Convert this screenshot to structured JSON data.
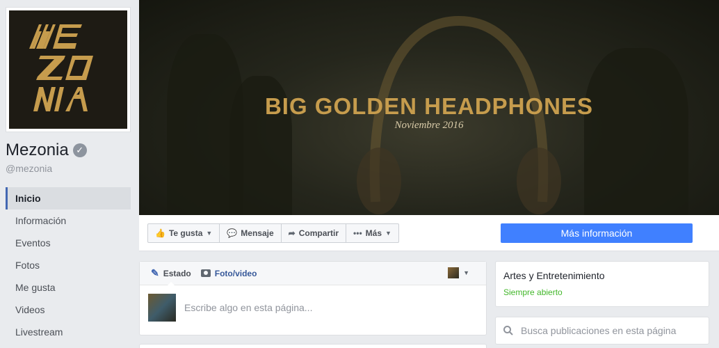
{
  "page": {
    "logo_text": [
      "ME",
      "ZO",
      "NIA"
    ],
    "name": "Mezonia",
    "handle": "@mezonia"
  },
  "nav": {
    "items": [
      {
        "label": "Inicio"
      },
      {
        "label": "Información"
      },
      {
        "label": "Eventos"
      },
      {
        "label": "Fotos"
      },
      {
        "label": "Me gusta"
      },
      {
        "label": "Videos"
      },
      {
        "label": "Livestream"
      }
    ],
    "active": "Inicio"
  },
  "cover": {
    "title": "BIG GOLDEN HEADPHONES",
    "subtitle": "Noviembre 2016"
  },
  "actions": {
    "like": "Te gusta",
    "message": "Mensaje",
    "share": "Compartir",
    "more": "Más",
    "cta": "Más información"
  },
  "composer": {
    "tab_status": "Estado",
    "tab_photo": "Foto/video",
    "placeholder": "Escribe algo en esta página..."
  },
  "info": {
    "category": "Artes y Entretenimiento",
    "hours": "Siempre abierto"
  },
  "search": {
    "placeholder": "Busca publicaciones en esta página"
  },
  "colors": {
    "accent": "#4267b2",
    "cta": "#4080ff",
    "gold": "#c69c4d",
    "open_green": "#42b72a"
  }
}
